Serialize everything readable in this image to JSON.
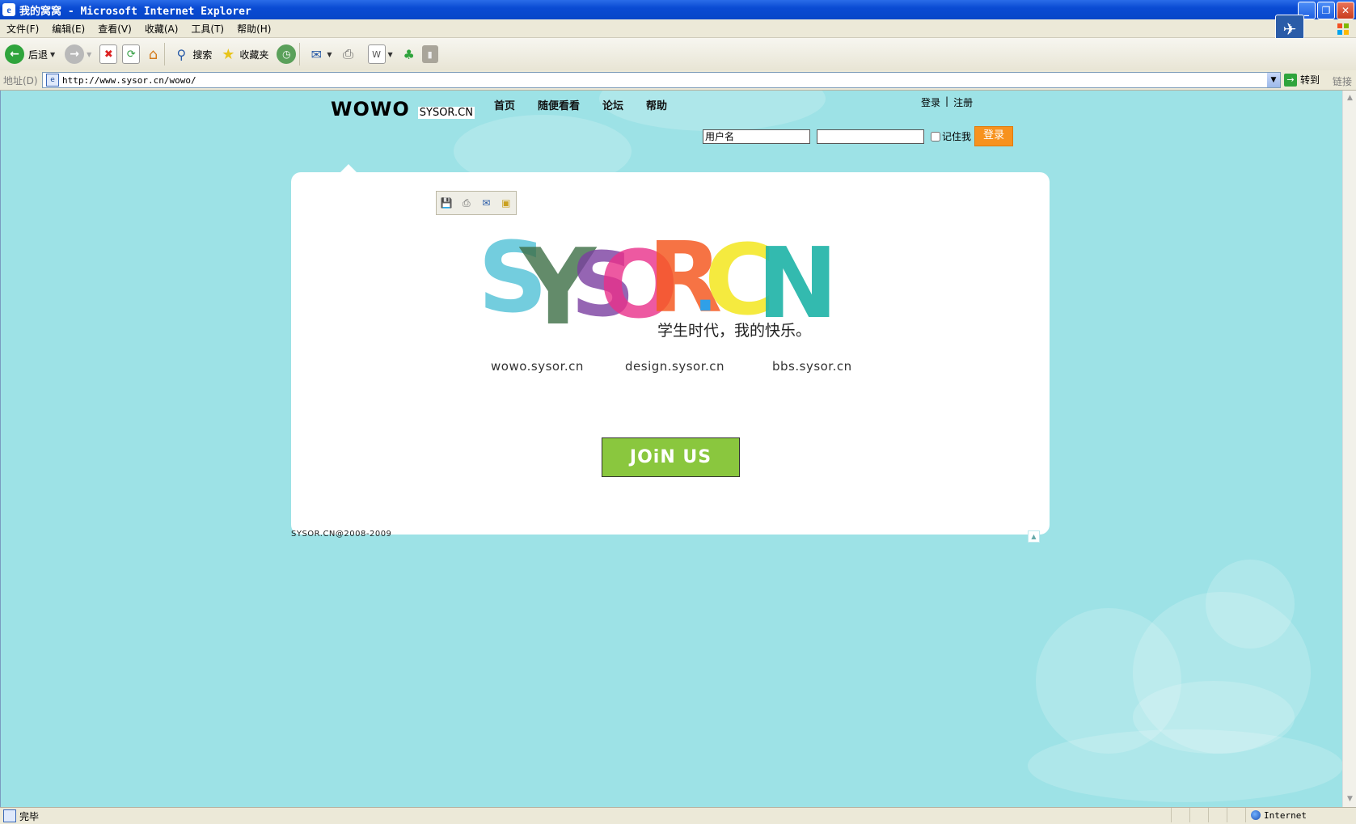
{
  "window": {
    "title": "我的窝窝 - Microsoft Internet Explorer",
    "controls": [
      "_",
      "❐",
      "✕"
    ]
  },
  "menu": [
    "文件(F)",
    "编辑(E)",
    "查看(V)",
    "收藏(A)",
    "工具(T)",
    "帮助(H)"
  ],
  "toolbar": {
    "back_label": "后退",
    "search_label": "搜索",
    "favorites_label": "收藏夹"
  },
  "address": {
    "label": "地址(D)",
    "url": "http://www.sysor.cn/wowo/",
    "go_label": "转到",
    "links_label": "链接"
  },
  "page": {
    "logo_main": "WOWO",
    "logo_sub": "SYSOR.CN",
    "nav": [
      "首页",
      "随便看看",
      "论坛",
      "帮助"
    ],
    "login_link": "登录",
    "register_link": "注册",
    "username_placeholder": "用户名",
    "remember_label": "记住我",
    "login_button": "登录",
    "hero_letters": [
      "S",
      "Y",
      "S",
      "O",
      "R",
      ".",
      "C",
      "N"
    ],
    "slogan": "学生时代，我的快乐。",
    "sublinks": [
      "wowo.sysor.cn",
      "design.sysor.cn",
      "bbs.sysor.cn"
    ],
    "join_button": "JOiN US",
    "copyright": "SYSOR.CN@2008-2009"
  },
  "status": {
    "text": "完毕",
    "zone": "Internet"
  },
  "colors": {
    "background": "#9de2e6",
    "join_button": "#8ac73e",
    "login_button": "#f7921e"
  }
}
